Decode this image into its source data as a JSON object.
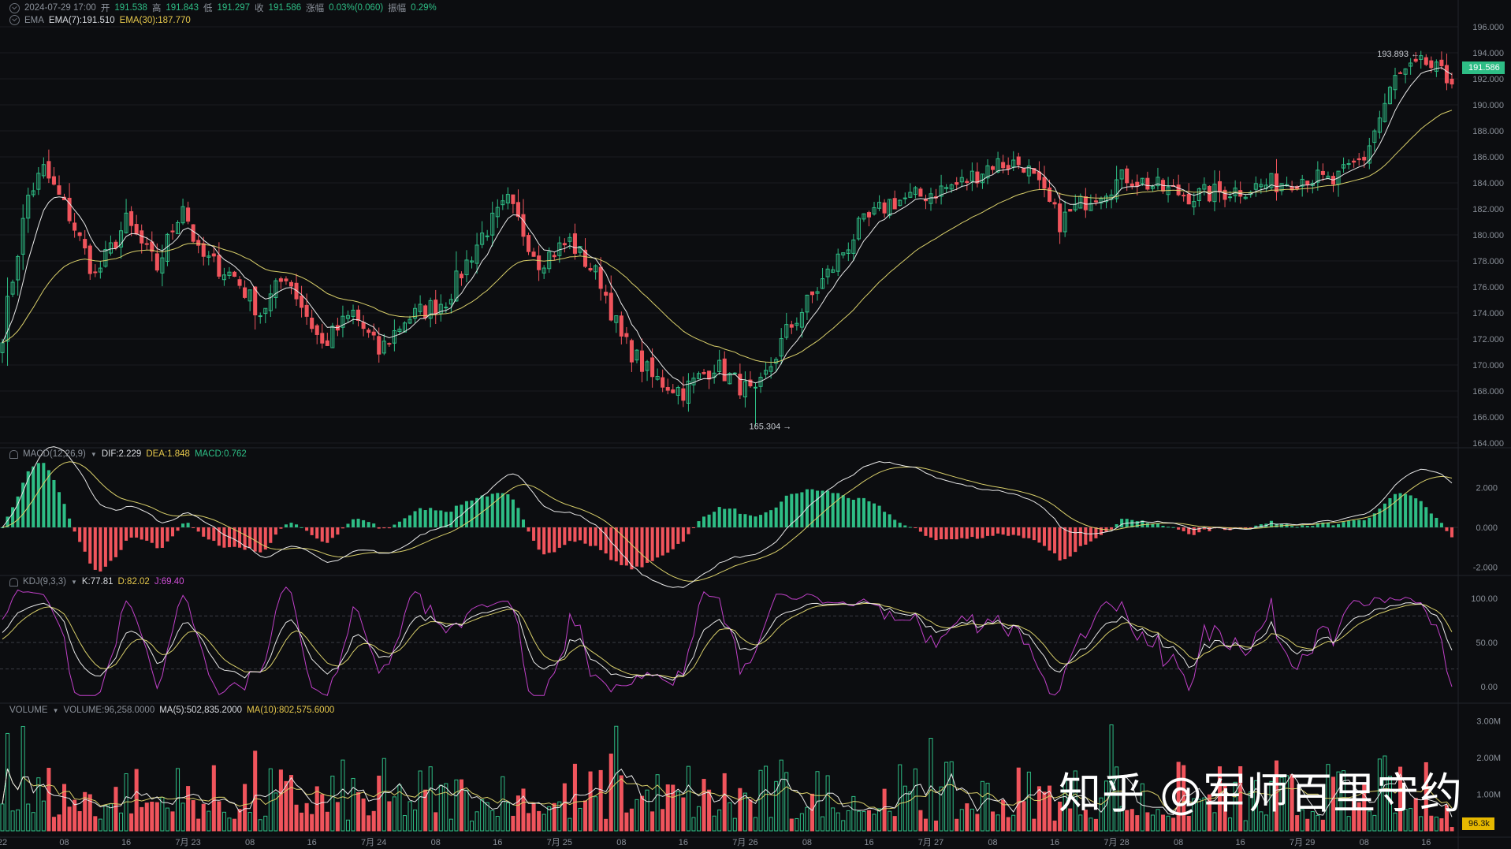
{
  "watermark": "知乎 @军师百里守约",
  "header": {
    "date": "2024-07-29 17:00",
    "open_label": "开",
    "open": "191.538",
    "high_label": "高",
    "high": "191.843",
    "low_label": "低",
    "low": "191.297",
    "close_label": "收",
    "close": "191.586",
    "change_label": "涨幅",
    "change": "0.03%(0.060)",
    "amp_label": "振幅",
    "amp": "0.29%"
  },
  "ema_legend": {
    "name": "EMA",
    "ema7": "EMA(7):191.510",
    "ema30": "EMA(30):187.770"
  },
  "macd_legend": {
    "name": "MACD(12,26,9)",
    "dif": "DIF:2.229",
    "dea": "DEA:1.848",
    "macd": "MACD:0.762"
  },
  "kdj_legend": {
    "name": "KDJ(9,3,3)",
    "k": "K:77.81",
    "d": "D:82.02",
    "j": "J:69.40"
  },
  "vol_legend": {
    "name": "VOLUME",
    "vol": "VOLUME:96,258.0000",
    "ma5": "MA(5):502,835.2000",
    "ma10": "MA(10):802,575.6000"
  },
  "current_price": "191.586",
  "current_volume": "96.3k",
  "colors": {
    "up": "#2ebd85",
    "down": "#f0545c",
    "ema7": "#e8e8e8",
    "ema30": "#d9cf6a",
    "k": "#e8e8e8",
    "d": "#d9cf6a",
    "j": "#c040c8",
    "bg": "#0c0d10",
    "grid": "#1a1c21"
  },
  "chart_data": {
    "type": "candlestick",
    "price_axis": {
      "ticks": [
        "196.000",
        "194.000",
        "192.000",
        "190.000",
        "188.000",
        "186.000",
        "184.000",
        "182.000",
        "180.000",
        "178.000",
        "176.000",
        "174.000",
        "172.000",
        "170.000",
        "168.000",
        "166.000",
        "164.000"
      ],
      "range": [
        164,
        196
      ]
    },
    "macd_axis": {
      "ticks": [
        "2.000",
        "0.000",
        "-2.000"
      ],
      "range": [
        -2.8,
        3.1
      ]
    },
    "kdj_axis": {
      "ticks": [
        "100.00",
        "50.00",
        "0.00"
      ],
      "range": [
        -15,
        125
      ]
    },
    "volume_axis": {
      "ticks": [
        "3.00M",
        "2.00M",
        "1.00M"
      ],
      "range": [
        0,
        3.2
      ]
    },
    "x_axis": {
      "ticks": [
        "22",
        "08",
        "16",
        "7月 23",
        "08",
        "16",
        "7月 24",
        "08",
        "16",
        "7月 25",
        "08",
        "16",
        "7月 26",
        "08",
        "16",
        "7月 27",
        "08",
        "16",
        "7月 28",
        "08",
        "16",
        "7月 29",
        "08",
        "16"
      ]
    },
    "annotations": {
      "high": "193.893",
      "low": "165.304"
    },
    "anchors": [
      [
        0,
        172.5
      ],
      [
        5,
        183
      ],
      [
        8,
        185
      ],
      [
        13,
        181.5
      ],
      [
        18,
        176.8
      ],
      [
        24,
        181
      ],
      [
        30,
        177.5
      ],
      [
        35,
        182.5
      ],
      [
        38,
        178.5
      ],
      [
        45,
        176.8
      ],
      [
        50,
        174
      ],
      [
        55,
        177
      ],
      [
        62,
        171.5
      ],
      [
        68,
        174
      ],
      [
        73,
        171
      ],
      [
        78,
        173.5
      ],
      [
        86,
        175
      ],
      [
        93,
        180
      ],
      [
        98,
        182.5
      ],
      [
        104,
        178
      ],
      [
        110,
        179.5
      ],
      [
        116,
        176.5
      ],
      [
        120,
        172
      ],
      [
        126,
        169
      ],
      [
        132,
        168
      ],
      [
        138,
        170
      ],
      [
        146,
        167.5
      ],
      [
        152,
        172.5
      ],
      [
        160,
        177
      ],
      [
        166,
        180.5
      ],
      [
        172,
        182.5
      ],
      [
        178,
        183
      ],
      [
        186,
        184
      ],
      [
        192,
        185.5
      ],
      [
        198,
        185.5
      ],
      [
        205,
        181
      ],
      [
        211,
        183
      ],
      [
        218,
        184.5
      ],
      [
        225,
        183.5
      ],
      [
        231,
        183
      ],
      [
        240,
        183.5
      ],
      [
        247,
        184
      ],
      [
        253,
        184.5
      ],
      [
        258,
        184
      ],
      [
        264,
        186
      ],
      [
        270,
        192
      ],
      [
        276,
        193.2
      ],
      [
        281,
        191.6
      ]
    ],
    "volume": {
      "unit": "M",
      "current": 0.096,
      "ma5": 0.503,
      "ma10": 0.803
    },
    "macd": {
      "dif": 2.229,
      "dea": 1.848,
      "macd": 0.762
    },
    "kdj": {
      "k": 77.81,
      "d": 82.02,
      "j": 69.4
    }
  }
}
